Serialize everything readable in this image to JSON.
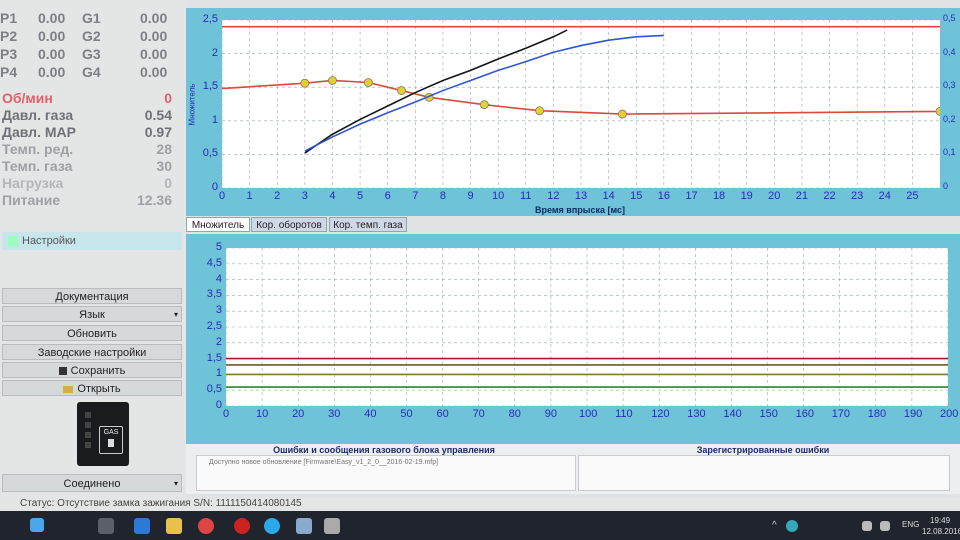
{
  "sensors": [
    {
      "p": "P1",
      "p_val": "0.00",
      "g": "G1",
      "g_val": "0.00"
    },
    {
      "p": "P2",
      "p_val": "0.00",
      "g": "G2",
      "g_val": "0.00"
    },
    {
      "p": "P3",
      "p_val": "0.00",
      "g": "G3",
      "g_val": "0.00"
    },
    {
      "p": "P4",
      "p_val": "0.00",
      "g": "G4",
      "g_val": "0.00"
    }
  ],
  "params": [
    {
      "label": "Об/мин",
      "value": "0",
      "color": "#e2606a"
    },
    {
      "label": "Давл. газа",
      "value": "0.54",
      "color": "#6f7178"
    },
    {
      "label": "Давл. MAP",
      "value": "0.97",
      "color": "#6f7178"
    },
    {
      "label": "Темп. ред.",
      "value": "28",
      "color": "#9ea0a6"
    },
    {
      "label": "Темп. газа",
      "value": "30",
      "color": "#9ea0a6"
    },
    {
      "label": "Нагрузка",
      "value": "0",
      "color": "#b4b6bb"
    },
    {
      "label": "Питание",
      "value": "12.36",
      "color": "#9ea0a6"
    }
  ],
  "settings_label": "Настройки",
  "buttons": {
    "docs": "Документация",
    "language": "Язык",
    "update": "Обновить",
    "factory": "Заводские настройки",
    "save": "Сохранить",
    "open": "Открыть"
  },
  "connection_status": "Соединено",
  "gas_label": "GAS",
  "status_bar": "Статус: Отсутствие замка зажигания S/N: 1111150414080145",
  "tabs": [
    "Множитель",
    "Кор. оборотов",
    "Кор. темп. газа"
  ],
  "errors_title": "Ошибки и сообщения газового блока управления",
  "registered_title": "Зарегистрированные ошибки",
  "update_message": "Доступно новое обновление [Firmware\\Easy_v1_2_0__2016-02-19.mfp]",
  "clock": {
    "time": "19:49",
    "date": "12.08.2016"
  },
  "lang_indicator": "ENG",
  "chart_data": [
    {
      "type": "scatter",
      "title": "",
      "xlabel": "Время впрыска [мс]",
      "ylabel": "Множитель",
      "xlim": [
        0,
        26
      ],
      "ylim": [
        0,
        2.5
      ],
      "y2lim": [
        0,
        0.5
      ],
      "x_ticks": [
        "0",
        "1",
        "2",
        "3",
        "4",
        "5",
        "6",
        "7",
        "8",
        "9",
        "10",
        "11",
        "12",
        "13",
        "14",
        "15",
        "16",
        "17",
        "18",
        "19",
        "20",
        "21",
        "22",
        "23",
        "24",
        "25"
      ],
      "y_ticks": [
        "0",
        "0,5",
        "1",
        "1,5",
        "2",
        "2,5"
      ],
      "y2_ticks": [
        "0",
        "0,1",
        "0,2",
        "0,3",
        "0,4",
        "0,5"
      ],
      "grid": true,
      "series": [
        {
          "color": "#d94a3a",
          "type": "line",
          "x": [
            0,
            3,
            4,
            5.3,
            6.5,
            7.5,
            9.5,
            11.5,
            14.5,
            26
          ],
          "y": [
            1.48,
            1.56,
            1.6,
            1.57,
            1.45,
            1.35,
            1.24,
            1.15,
            1.1,
            1.14
          ]
        },
        {
          "color": "#e8d02a",
          "type": "markers",
          "x": [
            3,
            4,
            5.3,
            6.5,
            7.5,
            9.5,
            11.5,
            14.5,
            26
          ],
          "y": [
            1.56,
            1.6,
            1.57,
            1.45,
            1.35,
            1.24,
            1.15,
            1.1,
            1.14
          ]
        },
        {
          "color": "#151515",
          "type": "line",
          "x": [
            3,
            4,
            5,
            6,
            7,
            8,
            9,
            10,
            11,
            12,
            12.5
          ],
          "y": [
            0.52,
            0.8,
            1.02,
            1.22,
            1.42,
            1.6,
            1.75,
            1.92,
            2.08,
            2.25,
            2.35
          ]
        },
        {
          "color": "#2d55d8",
          "type": "line",
          "x": [
            3,
            4,
            5,
            6,
            7,
            8,
            9,
            10,
            11,
            12,
            13,
            14,
            15,
            16
          ],
          "y": [
            0.55,
            0.76,
            0.95,
            1.12,
            1.28,
            1.45,
            1.6,
            1.75,
            1.88,
            2.02,
            2.12,
            2.2,
            2.25,
            2.27
          ]
        },
        {
          "color": "#d94a3a",
          "type": "line",
          "x": [
            0,
            26
          ],
          "y": [
            2.4,
            2.4
          ]
        }
      ]
    },
    {
      "type": "line",
      "title": "",
      "xlabel": "",
      "ylabel": "",
      "xlim": [
        0,
        200
      ],
      "ylim": [
        0,
        5
      ],
      "x_ticks": [
        "0",
        "10",
        "20",
        "30",
        "40",
        "50",
        "60",
        "70",
        "80",
        "90",
        "100",
        "110",
        "120",
        "130",
        "140",
        "150",
        "160",
        "170",
        "180",
        "190",
        "200"
      ],
      "y_ticks": [
        "0",
        "0,5",
        "1",
        "1,5",
        "2",
        "2,5",
        "3",
        "3,5",
        "4",
        "4,5",
        "5"
      ],
      "grid": true,
      "series": [
        {
          "color": "#a01c2a",
          "x": [
            0,
            200
          ],
          "y": [
            1.5,
            1.5
          ]
        },
        {
          "color": "#6b5a2a",
          "x": [
            0,
            200
          ],
          "y": [
            1.3,
            1.3
          ]
        },
        {
          "color": "#7a7a30",
          "x": [
            0,
            200
          ],
          "y": [
            1.0,
            1.0
          ]
        },
        {
          "color": "#2a8a2a",
          "x": [
            0,
            200
          ],
          "y": [
            0.6,
            0.6
          ]
        }
      ]
    }
  ]
}
